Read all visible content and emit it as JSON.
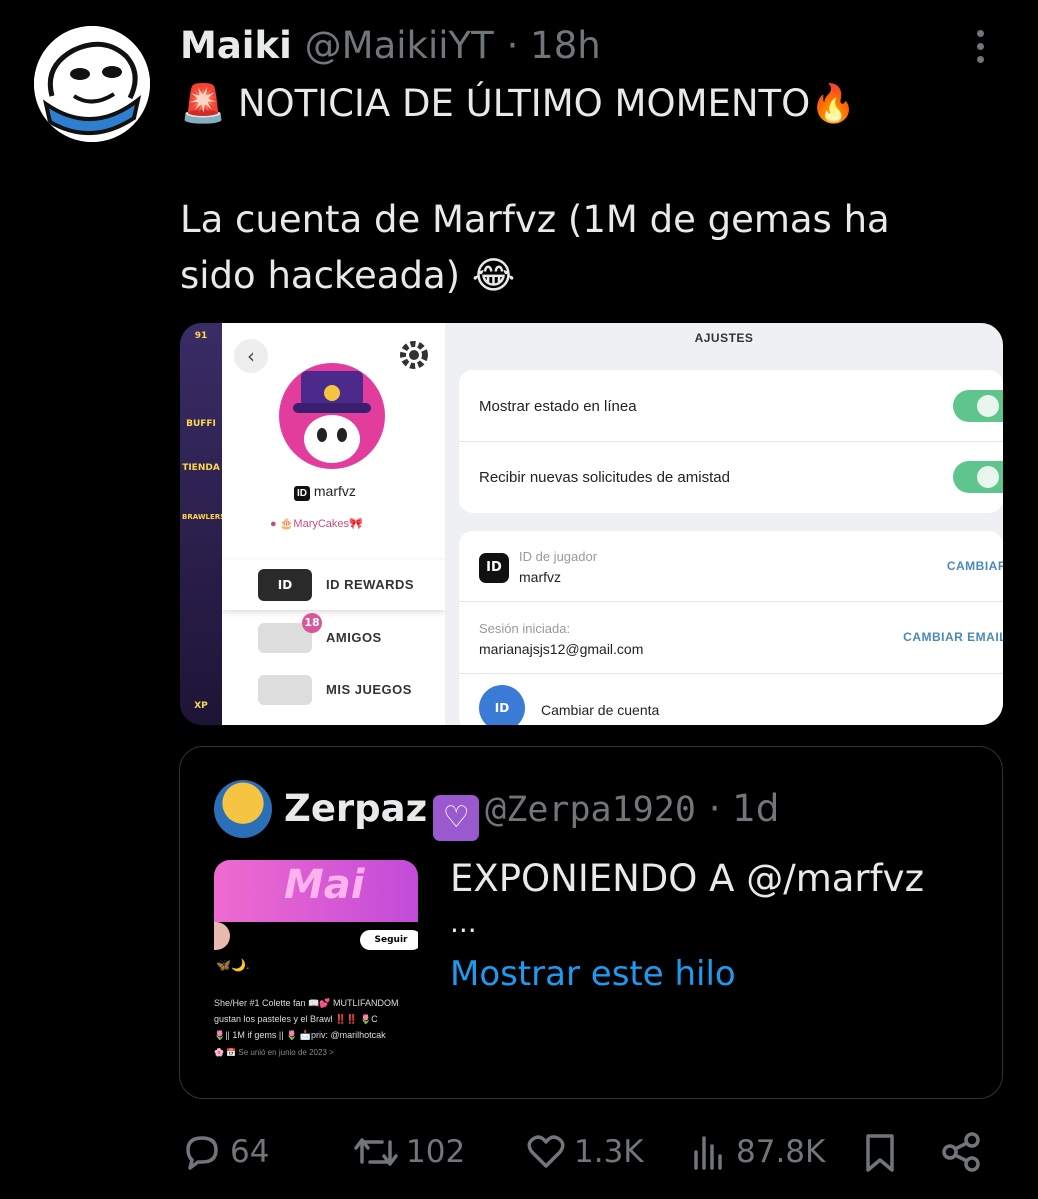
{
  "tweet": {
    "author_name": "Maiki",
    "author_handle": "@MaikiiYT",
    "time": "· 18h",
    "line1_emoji": "🚨",
    "line1_text": "NOTICIA DE ÚLTIMO MOMENTO",
    "line1_emoji_end": "🔥",
    "line2": "La cuenta de Marfvz (1M de gemas ha",
    "line3_text": "sido hackeada)",
    "line3_emoji": "😂"
  },
  "screenshot": {
    "game_strip": [
      "91",
      "BUFFI",
      "TIENDA",
      "BRAWLERS",
      "XP"
    ],
    "profile": {
      "id_badge": "ID",
      "username": "marfvz",
      "club": "🎂MaryCakes🎀"
    },
    "menu": [
      {
        "label": "ID REWARDS",
        "badge": ""
      },
      {
        "label": "AMIGOS",
        "badge": "18"
      },
      {
        "label": "MIS JUEGOS",
        "badge": ""
      }
    ],
    "settings_title": "AJUSTES",
    "settings": {
      "online_status": "Mostrar estado en línea",
      "friend_requests": "Recibir nuevas solicitudes de amistad",
      "player_id_label": "ID de jugador",
      "player_id_value": "marfvz",
      "player_id_action": "CAMBIAR",
      "session_label": "Sesión iniciada:",
      "session_email": "marianajsjs12@gmail.com",
      "session_action": "CAMBIAR EMAIL",
      "switch_account": "Cambiar de cuenta"
    }
  },
  "quote": {
    "author_name": "Zerpaz",
    "heart": "♡",
    "author_handle": "@Zerpa1920",
    "time": "· 1d",
    "text": "EXPONIENDO A @/marfvz",
    "ellipsis": "...",
    "show_thread": "Mostrar este hilo",
    "media": {
      "banner_text": "Mai",
      "follow": "Seguir",
      "bio1": "She/Her #1 Colette fan 📖💕 MUTLIFANDOM",
      "bio2": "gustan los pasteles y el Brawl ‼️‼️ 🌷C",
      "bio3": "🌷|| 1M if gems || 🌷 📩priv: @marilhotcak",
      "bio4": "🌸 📅 Se unió en junio de 2023 >"
    }
  },
  "actions": {
    "replies": "64",
    "reposts": "102",
    "likes": "1.3K",
    "views": "87.8K"
  },
  "colors": {
    "background": "#000000",
    "text": "#e7e9ea",
    "secondary": "#71767b",
    "link": "#1d9bf0",
    "toggle_on": "#5ec58c"
  }
}
